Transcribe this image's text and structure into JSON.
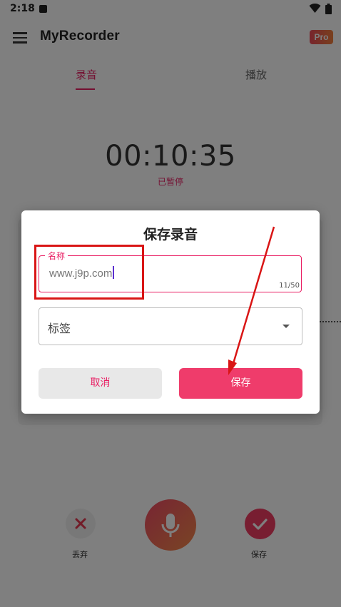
{
  "status_bar": {
    "time": "2:18"
  },
  "app_bar": {
    "title": "MyRecorder",
    "badge": "Pro"
  },
  "tabs": [
    {
      "label": "录音",
      "active": true
    },
    {
      "label": "播放",
      "active": false
    }
  ],
  "recorder": {
    "timer": "00:10:35",
    "status": "已暂停"
  },
  "controls": {
    "discard_label": "丢弃",
    "save_label": "保存"
  },
  "dialog": {
    "title": "保存录音",
    "name_field": {
      "label": "名称",
      "value": "www.j9p.com",
      "counter": "11/50"
    },
    "tag_field": {
      "label": "标签"
    },
    "cancel_label": "取消",
    "save_label": "保存"
  },
  "colors": {
    "accent": "#e91e63",
    "save_button": "#ef3c6b",
    "annotation": "#d91515"
  }
}
